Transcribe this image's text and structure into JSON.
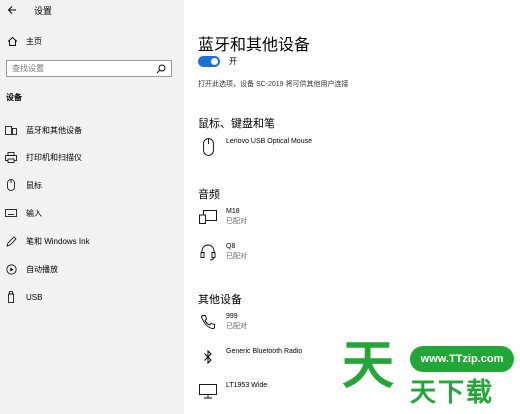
{
  "window": {
    "title": "设置"
  },
  "sidebar": {
    "home_label": "主页",
    "search_placeholder": "查找设置",
    "section_title": "设备",
    "items": [
      {
        "label": "蓝牙和其他设备",
        "icon": "bluetooth-devices-icon"
      },
      {
        "label": "打印机和扫描仪",
        "icon": "printer-icon"
      },
      {
        "label": "鼠标",
        "icon": "mouse-icon"
      },
      {
        "label": "输入",
        "icon": "keyboard-icon"
      },
      {
        "label": "笔和 Windows Ink",
        "icon": "pen-icon"
      },
      {
        "label": "自动播放",
        "icon": "autoplay-icon"
      },
      {
        "label": "USB",
        "icon": "usb-icon"
      }
    ]
  },
  "main": {
    "title": "蓝牙和其他设备",
    "bluetooth_toggle": {
      "label": "开",
      "on": true
    },
    "description": "打开此选项，设备 SC-2019 将可供其他用户连接",
    "sections": [
      {
        "title": "鼠标、键盘和笔",
        "devices": [
          {
            "name": "Lenovo USB Optical Mouse",
            "status": "",
            "icon": "mouse-icon"
          }
        ]
      },
      {
        "title": "音频",
        "devices": [
          {
            "name": "M18",
            "status": "已配对",
            "icon": "speaker-display-icon"
          },
          {
            "name": "Q8",
            "status": "已配对",
            "icon": "headset-icon"
          }
        ]
      },
      {
        "title": "其他设备",
        "devices": [
          {
            "name": "999",
            "status": "已配对",
            "icon": "phone-icon"
          },
          {
            "name": "Generic Bluetooth Radio",
            "status": "",
            "icon": "bluetooth-icon"
          },
          {
            "name": "LT1953 Wide",
            "status": "",
            "icon": "monitor-icon"
          }
        ]
      }
    ]
  },
  "watermark": {
    "url": "www.TTzip.com",
    "big_char": "天",
    "text": "天下载",
    "color": "#23a638"
  },
  "colors": {
    "accent": "#1a73d4",
    "sidebar_bg": "#f2f2f2"
  }
}
